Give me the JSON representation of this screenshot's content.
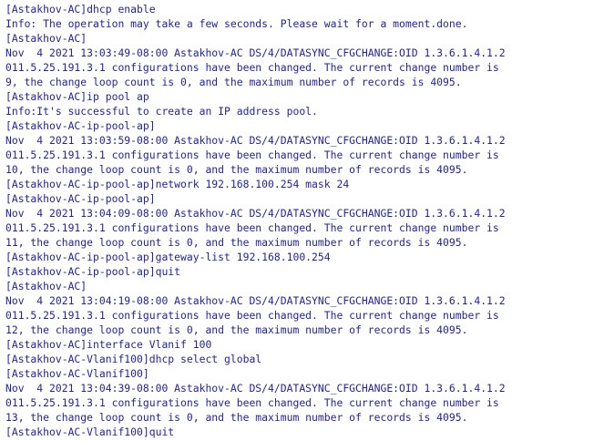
{
  "terminal": {
    "colors": {
      "background": "#ffffff",
      "text": "#2323a0"
    },
    "lines": [
      "[Astakhov-AC]dhcp enable",
      "Info: The operation may take a few seconds. Please wait for a moment.done.",
      "[Astakhov-AC]",
      "Nov  4 2021 13:03:49-08:00 Astakhov-AC DS/4/DATASYNC_CFGCHANGE:OID 1.3.6.1.4.1.2",
      "011.5.25.191.3.1 configurations have been changed. The current change number is",
      "9, the change loop count is 0, and the maximum number of records is 4095.",
      "[Astakhov-AC]ip pool ap",
      "Info:It's successful to create an IP address pool.",
      "[Astakhov-AC-ip-pool-ap]",
      "Nov  4 2021 13:03:59-08:00 Astakhov-AC DS/4/DATASYNC_CFGCHANGE:OID 1.3.6.1.4.1.2",
      "011.5.25.191.3.1 configurations have been changed. The current change number is",
      "10, the change loop count is 0, and the maximum number of records is 4095.",
      "[Astakhov-AC-ip-pool-ap]network 192.168.100.254 mask 24",
      "[Astakhov-AC-ip-pool-ap]",
      "Nov  4 2021 13:04:09-08:00 Astakhov-AC DS/4/DATASYNC_CFGCHANGE:OID 1.3.6.1.4.1.2",
      "011.5.25.191.3.1 configurations have been changed. The current change number is",
      "11, the change loop count is 0, and the maximum number of records is 4095.",
      "[Astakhov-AC-ip-pool-ap]gateway-list 192.168.100.254",
      "[Astakhov-AC-ip-pool-ap]quit",
      "[Astakhov-AC]",
      "Nov  4 2021 13:04:19-08:00 Astakhov-AC DS/4/DATASYNC_CFGCHANGE:OID 1.3.6.1.4.1.2",
      "011.5.25.191.3.1 configurations have been changed. The current change number is",
      "12, the change loop count is 0, and the maximum number of records is 4095.",
      "[Astakhov-AC]interface Vlanif 100",
      "[Astakhov-AC-Vlanif100]dhcp select global",
      "[Astakhov-AC-Vlanif100]",
      "Nov  4 2021 13:04:39-08:00 Astakhov-AC DS/4/DATASYNC_CFGCHANGE:OID 1.3.6.1.4.1.2",
      "011.5.25.191.3.1 configurations have been changed. The current change number is",
      "13, the change loop count is 0, and the maximum number of records is 4095.",
      "[Astakhov-AC-Vlanif100]quit"
    ]
  }
}
